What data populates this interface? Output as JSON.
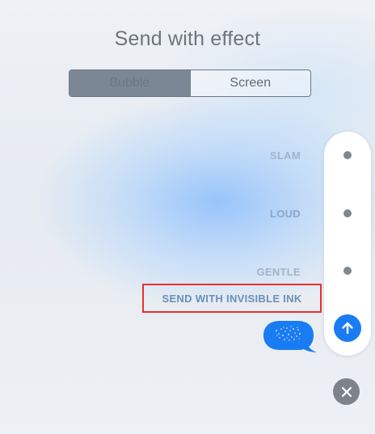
{
  "header": {
    "title": "Send with effect"
  },
  "effect_tabs": [
    {
      "label": "Bubble",
      "selected": true
    },
    {
      "label": "Screen",
      "selected": false
    }
  ],
  "bubble_effects": {
    "slam": "SLAM",
    "loud": "LOUD",
    "gentle": "GENTLE",
    "invisible_ink": "SEND WITH INVISIBLE INK"
  },
  "icons": {
    "send": "arrow-up-icon",
    "close": "close-icon"
  },
  "colors": {
    "accent": "#1a7cf2",
    "highlight_border": "#e8302f"
  }
}
